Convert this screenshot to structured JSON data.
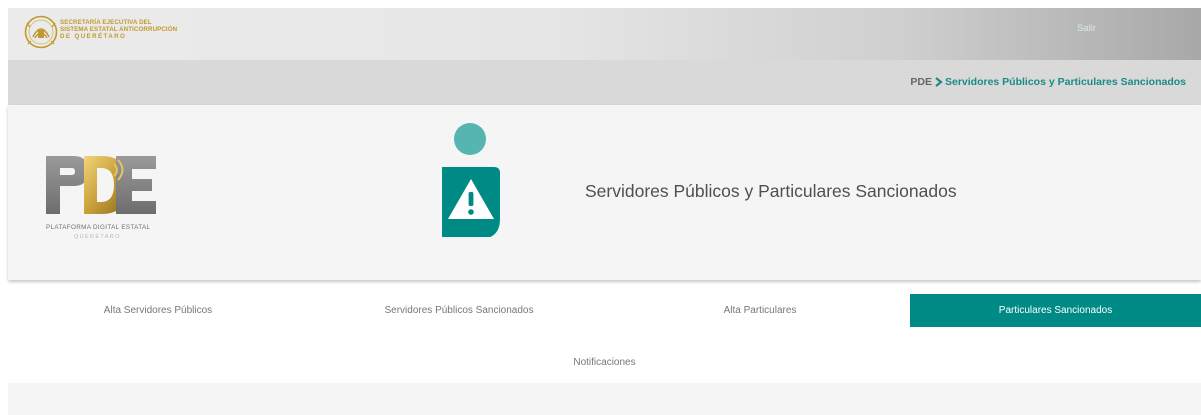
{
  "colors": {
    "accent": "#008a85",
    "accent_light": "#57b5b1",
    "breadcrumb_link": "#1a8b86",
    "gold": "#c19a2e"
  },
  "header": {
    "org_lines": [
      "SECRETARÍA EJECUTIVA DEL",
      "SISTEMA ESTATAL ANTICORRUPCIÓN",
      "DE QUERÉTARO"
    ],
    "seal_icon": "state-seal-icon",
    "logout_label": "Salir"
  },
  "breadcrumb": {
    "root": "PDE",
    "separator_icon": "chevron-right-icon",
    "current": "Servidores Públicos y Particulares Sancionados"
  },
  "hero": {
    "logo_letters": "PDE",
    "logo_caption": "PLATAFORMA DIGITAL ESTATAL",
    "logo_subcaption": "QUERÉTARO",
    "section_icon": "sanctioned-person-warning-icon",
    "title": "Servidores Públicos y Particulares Sancionados"
  },
  "tabs": [
    {
      "label": "Alta Servidores Públicos",
      "active": false
    },
    {
      "label": "Servidores Públicos Sancionados",
      "active": false
    },
    {
      "label": "Alta Particulares",
      "active": false
    },
    {
      "label": "Particulares Sancionados",
      "active": true
    }
  ],
  "secondary_tab": {
    "label": "Notificaciones"
  }
}
